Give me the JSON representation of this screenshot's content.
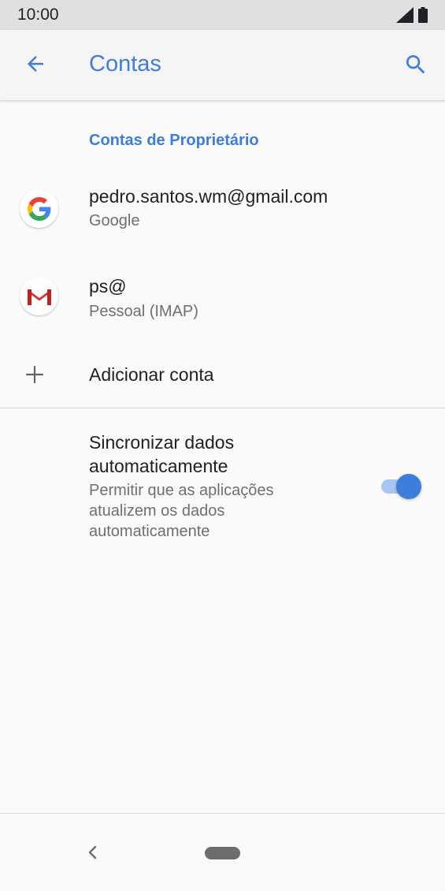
{
  "status_bar": {
    "time": "10:00",
    "icons": [
      "signal-icon",
      "battery-icon"
    ]
  },
  "app_bar": {
    "title": "Contas",
    "back_icon": "arrow-back-icon",
    "search_icon": "search-icon"
  },
  "owner_section": {
    "header": "Contas de Proprietário",
    "accounts": [
      {
        "title": "pedro.santos.wm@gmail.com",
        "subtitle": "Google",
        "icon": "google-icon"
      },
      {
        "title": "ps@",
        "subtitle": "Pessoal (IMAP)",
        "icon": "gmail-icon"
      }
    ],
    "add_account": {
      "label": "Adicionar conta",
      "icon": "plus-icon"
    }
  },
  "sync": {
    "title": "Sincronizar dados automaticamente",
    "description": "Permitir que as aplicações atualizem os dados automaticamente",
    "enabled": true
  },
  "colors": {
    "accent": "#3d7ddc",
    "toggle_track": "#a9c6f2"
  },
  "nav_bar": {
    "icons": [
      "nav-back-icon",
      "nav-home-pill"
    ]
  }
}
